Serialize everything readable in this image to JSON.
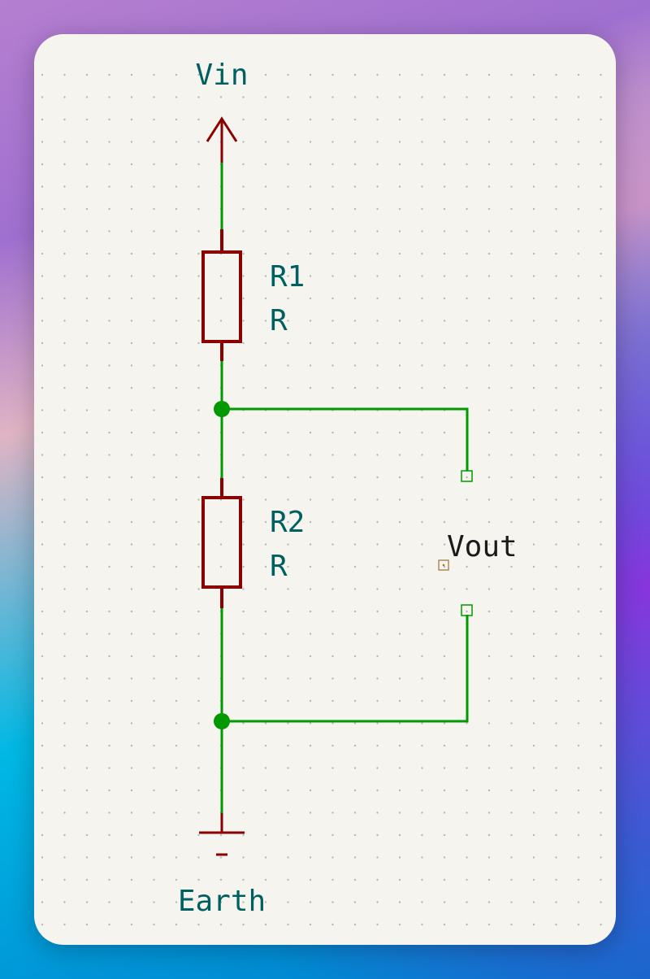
{
  "schematic": {
    "power_label": "Vin",
    "ground_label": "Earth",
    "components": [
      {
        "ref": "R1",
        "value": "R"
      },
      {
        "ref": "R2",
        "value": "R"
      }
    ],
    "output_label": "Vout"
  },
  "colors": {
    "wire": "#009900",
    "component": "#8b0000",
    "text": "#006060",
    "sheet": "#f5f4ef",
    "grid_dot": "#b8b8b4"
  }
}
